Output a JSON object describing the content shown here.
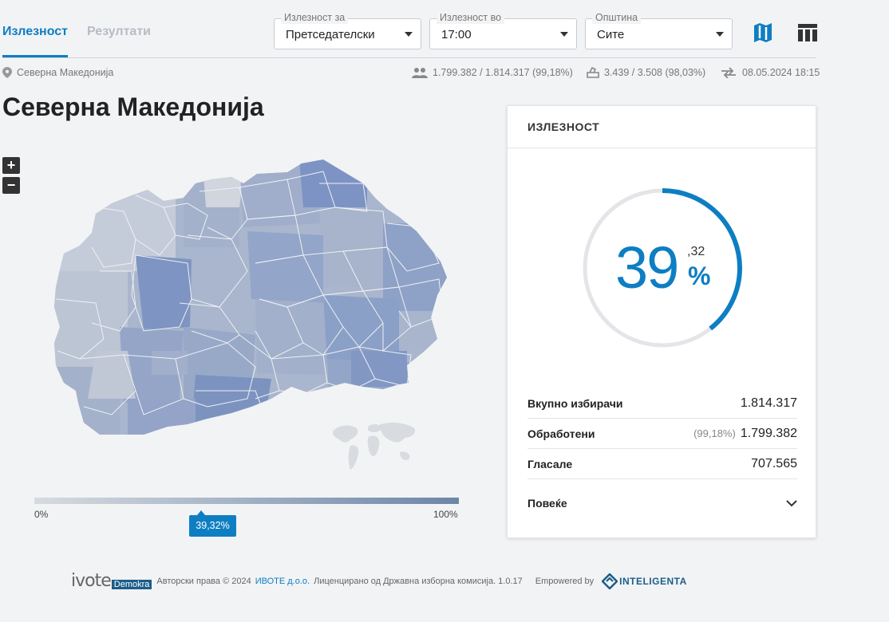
{
  "tabs": [
    {
      "label": "Излезност",
      "active": true
    },
    {
      "label": "Резултати",
      "active": false
    }
  ],
  "filters": {
    "turnout_for": {
      "legend": "Излезност за",
      "value": "Претседателски"
    },
    "turnout_at": {
      "legend": "Излезност во",
      "value": "17:00"
    },
    "municipality": {
      "legend": "Општина",
      "value": "Сите"
    }
  },
  "icons": {
    "map": "map-icon",
    "table": "table-icon"
  },
  "info": {
    "location": "Северна Македонија",
    "voters": "1.799.382 / 1.814.317 (99,18%)",
    "stations": "3.439 / 3.508 (98,03%)",
    "updated": "08.05.2024 18:15"
  },
  "title": "Северна Македонија",
  "zoom": {
    "in": "+",
    "out": "−"
  },
  "scale": {
    "min": "0%",
    "max": "100%",
    "marker": "39,32%",
    "value_fraction": 0.3932
  },
  "card": {
    "header": "ИЗЛЕЗНОСТ",
    "turnout_int": "39",
    "turnout_frac": ",32",
    "turnout_sign": "%",
    "turnout_value": 39.32,
    "rows": [
      {
        "label": "Вкупно избирачи",
        "sub": "",
        "value": "1.814.317"
      },
      {
        "label": "Обработени",
        "sub": "(99,18%)",
        "value": "1.799.382"
      },
      {
        "label": "Гласале",
        "sub": "",
        "value": "707.565"
      }
    ],
    "more": "Повеќе"
  },
  "footer": {
    "brand": "ivote",
    "brand_badge": "Demokra",
    "copyright": "Авторски права © 2024",
    "company": "ИВОТЕ д.о.о.",
    "license": "Лиценцирано од Државна изборна комисија. 1.0.17",
    "empowered": "Empowered by",
    "partner": "INTELIGENTA"
  },
  "colors": {
    "accent": "#0e7ec3",
    "map_light": "#c4ccd8",
    "map_dark": "#6d89be"
  }
}
